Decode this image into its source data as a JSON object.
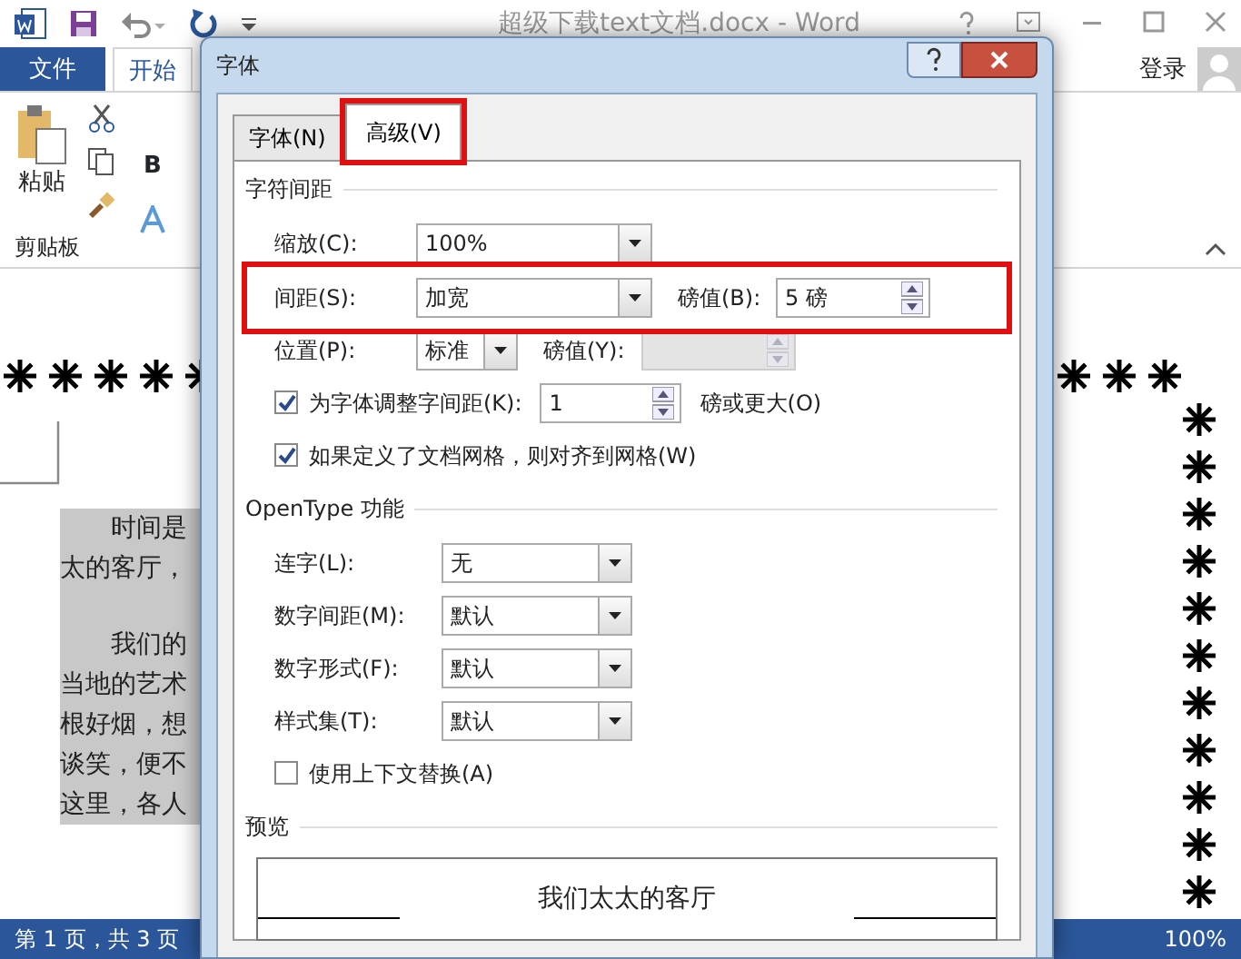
{
  "window": {
    "title": "超级下载text文档.docx - Word"
  },
  "ribbon": {
    "tabs": [
      {
        "label": "文件",
        "kind": "file",
        "selected": false
      },
      {
        "label": "开始",
        "kind": "tab",
        "selected": true
      }
    ],
    "sign_in": "登录",
    "paste": "粘贴",
    "bold": "B",
    "group": "剪贴板"
  },
  "document": {
    "paragraphs": [
      {
        "lines": [
          "时间是",
          "太的客厅，"
        ]
      },
      {
        "lines": [
          "我们的",
          "当地的艺术",
          "根好烟，想",
          "谈笑，便不",
          "这里，各人"
        ]
      }
    ]
  },
  "status_bar": {
    "page": "第 1 页，共 3 页",
    "zoom": "100%"
  },
  "dialog": {
    "title": "字体",
    "tabs": [
      {
        "label": "字体(N)",
        "selected": false,
        "highlighted": false
      },
      {
        "label": "高级(V)",
        "selected": true,
        "highlighted": true
      }
    ],
    "sections": [
      {
        "heading": "字符间距",
        "rows": [
          {
            "kind": "fields",
            "highlighted": false,
            "fields": [
              {
                "kind": "combo",
                "label": "缩放(C):",
                "value": "100%"
              }
            ]
          },
          {
            "kind": "fields",
            "highlighted": true,
            "fields": [
              {
                "kind": "combo",
                "label": "间距(S):",
                "value": "加宽"
              },
              {
                "kind": "spin",
                "label": "磅值(B):",
                "value": "5 磅",
                "disabled": false
              }
            ]
          },
          {
            "kind": "fields",
            "highlighted": false,
            "fields": [
              {
                "kind": "combo",
                "label": "位置(P):",
                "value": "标准"
              },
              {
                "kind": "spin",
                "label": "磅值(Y):",
                "disabled": true
              }
            ]
          },
          {
            "kind": "checkbox",
            "checked": true,
            "label": "为字体调整字间距(K):",
            "value": "1",
            "suffix": "磅或更大(O)"
          },
          {
            "kind": "checkbox",
            "checked": true,
            "label": "如果定义了文档网格，则对齐到网格(W)"
          }
        ]
      },
      {
        "heading": "OpenType 功能",
        "rows": [
          {
            "kind": "fields",
            "highlighted": false,
            "fields": [
              {
                "kind": "combo",
                "label": "连字(L):",
                "value": "无"
              }
            ]
          },
          {
            "kind": "fields",
            "highlighted": false,
            "fields": [
              {
                "kind": "combo",
                "label": "数字间距(M):",
                "value": "默认"
              }
            ]
          },
          {
            "kind": "fields",
            "highlighted": false,
            "fields": [
              {
                "kind": "combo",
                "label": "数字形式(F):",
                "value": "默认"
              }
            ]
          },
          {
            "kind": "fields",
            "highlighted": false,
            "fields": [
              {
                "kind": "combo",
                "label": "样式集(T):",
                "value": "默认"
              }
            ]
          },
          {
            "kind": "checkbox",
            "checked": false,
            "label": "使用上下文替换(A)"
          }
        ]
      }
    ],
    "preview": {
      "heading": "预览",
      "sample": "我们太太的客厅"
    }
  }
}
